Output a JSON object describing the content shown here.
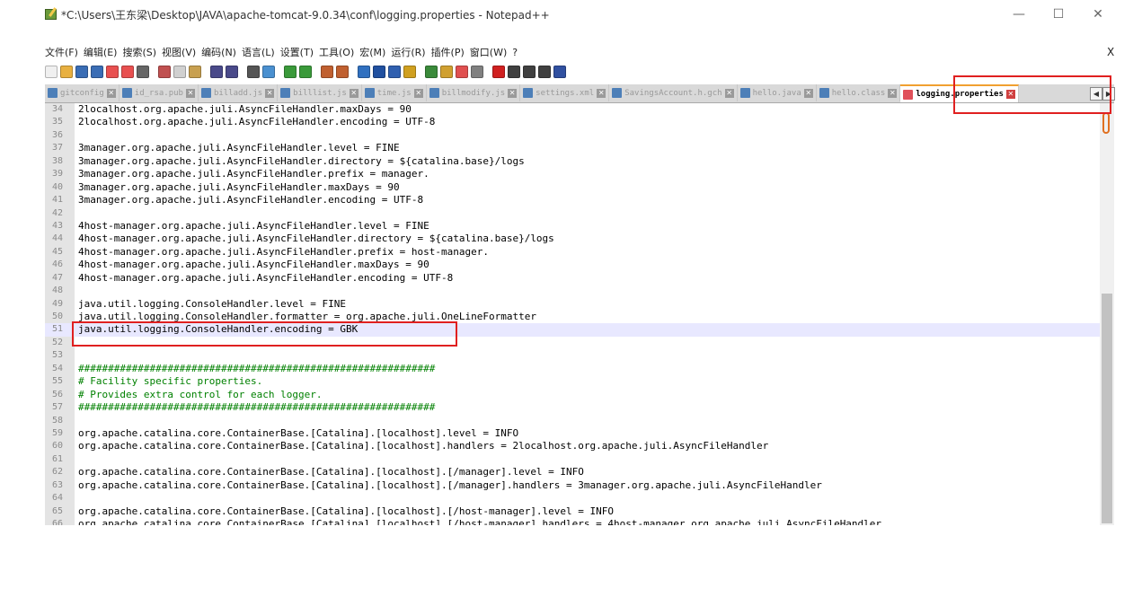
{
  "window": {
    "title": "*C:\\Users\\王东梁\\Desktop\\JAVA\\apache-tomcat-9.0.34\\conf\\logging.properties - Notepad++",
    "minimize": "—",
    "maximize": "☐",
    "close": "✕"
  },
  "menubar": {
    "items": [
      "文件(F)",
      "编辑(E)",
      "搜索(S)",
      "视图(V)",
      "编码(N)",
      "语言(L)",
      "设置(T)",
      "工具(O)",
      "宏(M)",
      "运行(R)",
      "插件(P)",
      "窗口(W)",
      "?"
    ],
    "close_doc": "X"
  },
  "toolbar": {
    "icons": [
      "new-file-icon",
      "open-file-icon",
      "save-icon",
      "save-all-icon",
      "close-icon",
      "close-all-icon",
      "print-icon",
      "cut-icon",
      "copy-icon",
      "paste-icon",
      "undo-icon",
      "redo-icon",
      "find-icon",
      "replace-icon",
      "zoom-in-icon",
      "zoom-out-icon",
      "sync-v-icon",
      "sync-h-icon",
      "wrap-icon",
      "all-chars-icon",
      "indent-guide-icon",
      "udl-icon",
      "doc-map-icon",
      "function-list-icon",
      "folder-workspace-icon",
      "monitor-icon",
      "record-macro-icon",
      "stop-macro-icon",
      "play-macro-icon",
      "run-macro-multiple-icon",
      "save-macro-icon"
    ]
  },
  "tabs": [
    {
      "label": "gitconfig",
      "active": false
    },
    {
      "label": "id_rsa.pub",
      "active": false
    },
    {
      "label": "billadd.js",
      "active": false
    },
    {
      "label": "billlist.js",
      "active": false
    },
    {
      "label": "time.js",
      "active": false
    },
    {
      "label": "billmodify.js",
      "active": false
    },
    {
      "label": "settings.xml",
      "active": false
    },
    {
      "label": "SavingsAccount.h.gch",
      "active": false
    },
    {
      "label": "hello.java",
      "active": false
    },
    {
      "label": "hello.class",
      "active": false
    },
    {
      "label": "logging.properties",
      "active": true
    }
  ],
  "tab_scroll": {
    "left": "◀",
    "right": "▶"
  },
  "editor": {
    "current_line": "51",
    "lines": [
      {
        "n": "34",
        "t": "2localhost.org.apache.juli.AsyncFileHandler.maxDays = 90",
        "c": false
      },
      {
        "n": "35",
        "t": "2localhost.org.apache.juli.AsyncFileHandler.encoding = UTF-8",
        "c": false
      },
      {
        "n": "36",
        "t": "",
        "c": false
      },
      {
        "n": "37",
        "t": "3manager.org.apache.juli.AsyncFileHandler.level = FINE",
        "c": false
      },
      {
        "n": "38",
        "t": "3manager.org.apache.juli.AsyncFileHandler.directory = ${catalina.base}/logs",
        "c": false
      },
      {
        "n": "39",
        "t": "3manager.org.apache.juli.AsyncFileHandler.prefix = manager.",
        "c": false
      },
      {
        "n": "40",
        "t": "3manager.org.apache.juli.AsyncFileHandler.maxDays = 90",
        "c": false
      },
      {
        "n": "41",
        "t": "3manager.org.apache.juli.AsyncFileHandler.encoding = UTF-8",
        "c": false
      },
      {
        "n": "42",
        "t": "",
        "c": false
      },
      {
        "n": "43",
        "t": "4host-manager.org.apache.juli.AsyncFileHandler.level = FINE",
        "c": false
      },
      {
        "n": "44",
        "t": "4host-manager.org.apache.juli.AsyncFileHandler.directory = ${catalina.base}/logs",
        "c": false
      },
      {
        "n": "45",
        "t": "4host-manager.org.apache.juli.AsyncFileHandler.prefix = host-manager.",
        "c": false
      },
      {
        "n": "46",
        "t": "4host-manager.org.apache.juli.AsyncFileHandler.maxDays = 90",
        "c": false
      },
      {
        "n": "47",
        "t": "4host-manager.org.apache.juli.AsyncFileHandler.encoding = UTF-8",
        "c": false
      },
      {
        "n": "48",
        "t": "",
        "c": false
      },
      {
        "n": "49",
        "t": "java.util.logging.ConsoleHandler.level = FINE",
        "c": false
      },
      {
        "n": "50",
        "t": "java.util.logging.ConsoleHandler.formatter = org.apache.juli.OneLineFormatter",
        "c": false
      },
      {
        "n": "51",
        "t": "java.util.logging.ConsoleHandler.encoding = GBK",
        "c": false
      },
      {
        "n": "52",
        "t": "",
        "c": false
      },
      {
        "n": "53",
        "t": "",
        "c": false
      },
      {
        "n": "54",
        "t": "############################################################",
        "c": true
      },
      {
        "n": "55",
        "t": "# Facility specific properties.",
        "c": true
      },
      {
        "n": "56",
        "t": "# Provides extra control for each logger.",
        "c": true
      },
      {
        "n": "57",
        "t": "############################################################",
        "c": true
      },
      {
        "n": "58",
        "t": "",
        "c": false
      },
      {
        "n": "59",
        "t": "org.apache.catalina.core.ContainerBase.[Catalina].[localhost].level = INFO",
        "c": false
      },
      {
        "n": "60",
        "t": "org.apache.catalina.core.ContainerBase.[Catalina].[localhost].handlers = 2localhost.org.apache.juli.AsyncFileHandler",
        "c": false
      },
      {
        "n": "61",
        "t": "",
        "c": false
      },
      {
        "n": "62",
        "t": "org.apache.catalina.core.ContainerBase.[Catalina].[localhost].[/manager].level = INFO",
        "c": false
      },
      {
        "n": "63",
        "t": "org.apache.catalina.core.ContainerBase.[Catalina].[localhost].[/manager].handlers = 3manager.org.apache.juli.AsyncFileHandler",
        "c": false
      },
      {
        "n": "64",
        "t": "",
        "c": false
      },
      {
        "n": "65",
        "t": "org.apache.catalina.core.ContainerBase.[Catalina].[localhost].[/host-manager].level = INFO",
        "c": false
      },
      {
        "n": "66",
        "t": "org.apache.catalina.core.ContainerBase.[Catalina].[localhost].[/host-manager].handlers = 4host-manager.org.apache.juli.AsyncFileHandler",
        "c": false
      }
    ]
  },
  "colors": {
    "annotation": "#e02020",
    "comment": "#008000",
    "current_line_bg": "#e8e8ff"
  }
}
